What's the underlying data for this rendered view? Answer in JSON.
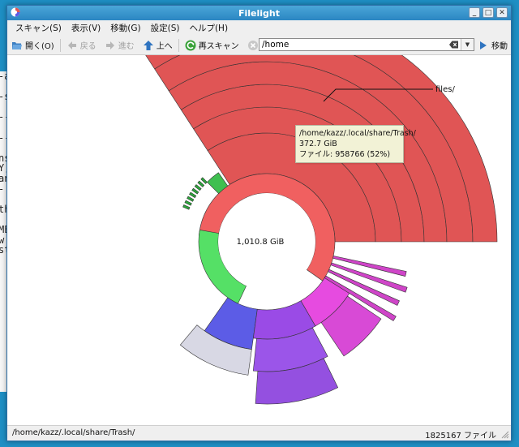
{
  "window": {
    "title": "Filelight"
  },
  "menubar": {
    "items": [
      {
        "label": "スキャン(S)"
      },
      {
        "label": "表示(V)"
      },
      {
        "label": "移動(G)"
      },
      {
        "label": "設定(S)"
      },
      {
        "label": "ヘルプ(H)"
      }
    ]
  },
  "toolbar": {
    "open_label": "開く(O)",
    "back_label": "戻る",
    "forward_label": "進む",
    "up_label": "上へ",
    "rescan_label": "再スキャン",
    "stop_label": "停止",
    "location_value": "/home",
    "go_label": "移動"
  },
  "map": {
    "center_label": "1,010.8 GiB",
    "pointer_label": "files/"
  },
  "tooltip": {
    "path": "/home/kazz/.local/share/Trash/",
    "size": "372.7 GiB",
    "files": "ファイル: 958766 (52%)"
  },
  "status": {
    "path": "/home/kazz/.local/share/Trash/",
    "count": "1825167 ファイル"
  },
  "background_window": {
    "text_fragments": [
      "-a",
      "",
      "-s",
      "",
      "--",
      "",
      "--",
      "",
      "ns",
      "Y,",
      "an",
      "-",
      "",
      "th",
      "",
      "ME",
      "w",
      "st"
    ]
  },
  "colors": {
    "trash": "#e05555",
    "green": "#55e066",
    "blue": "#5c5ce6",
    "violet": "#9a4be6",
    "magenta": "#e64be0",
    "grey": "#d8d8e4"
  }
}
